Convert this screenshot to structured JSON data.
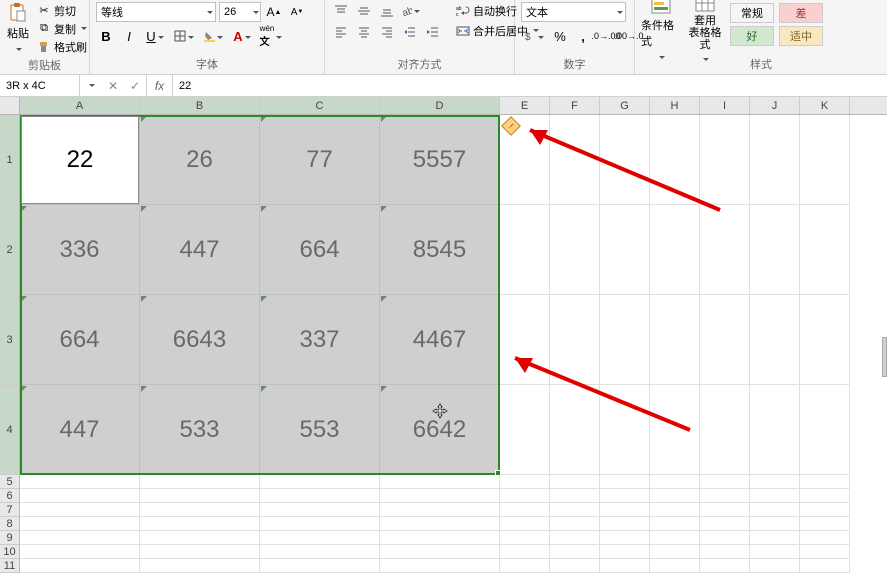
{
  "ribbon": {
    "clipboard": {
      "label": "剪贴板",
      "paste": "粘贴",
      "cut": "剪切",
      "copy": "复制",
      "format_painter": "格式刷"
    },
    "font": {
      "label": "字体",
      "name": "等线",
      "size": "26"
    },
    "alignment": {
      "label": "对齐方式",
      "wrap": "自动换行",
      "merge": "合并后居中"
    },
    "number": {
      "label": "数字",
      "format": "文本"
    },
    "styles": {
      "label": "样式",
      "cond_format": "条件格式",
      "table_format": "套用\n表格格式",
      "normal": "常规",
      "good": "好",
      "bad": "差",
      "neutral": "适中"
    }
  },
  "namebox": "3R x 4C",
  "formula": "22",
  "columns": [
    "A",
    "B",
    "C",
    "D",
    "E",
    "F",
    "G",
    "H",
    "I",
    "J",
    "K"
  ],
  "col_widths": {
    "data": 120,
    "rest": 50
  },
  "row_heights": {
    "data": 90,
    "rest": 14
  },
  "grid_data": [
    [
      "22",
      "26",
      "77",
      "5557"
    ],
    [
      "336",
      "447",
      "664",
      "8545"
    ],
    [
      "664",
      "6643",
      "337",
      "4467"
    ],
    [
      "447",
      "533",
      "553",
      "6642"
    ]
  ],
  "selection": {
    "rows": [
      1,
      4
    ],
    "cols": [
      1,
      4
    ]
  },
  "active_cell": {
    "row": 1,
    "col": 1
  },
  "chart_data": {
    "type": "table",
    "columns": [
      "A",
      "B",
      "C",
      "D"
    ],
    "rows": [
      [
        22,
        26,
        77,
        5557
      ],
      [
        336,
        447,
        664,
        8545
      ],
      [
        664,
        6643,
        337,
        4467
      ],
      [
        447,
        533,
        553,
        6642
      ]
    ]
  }
}
